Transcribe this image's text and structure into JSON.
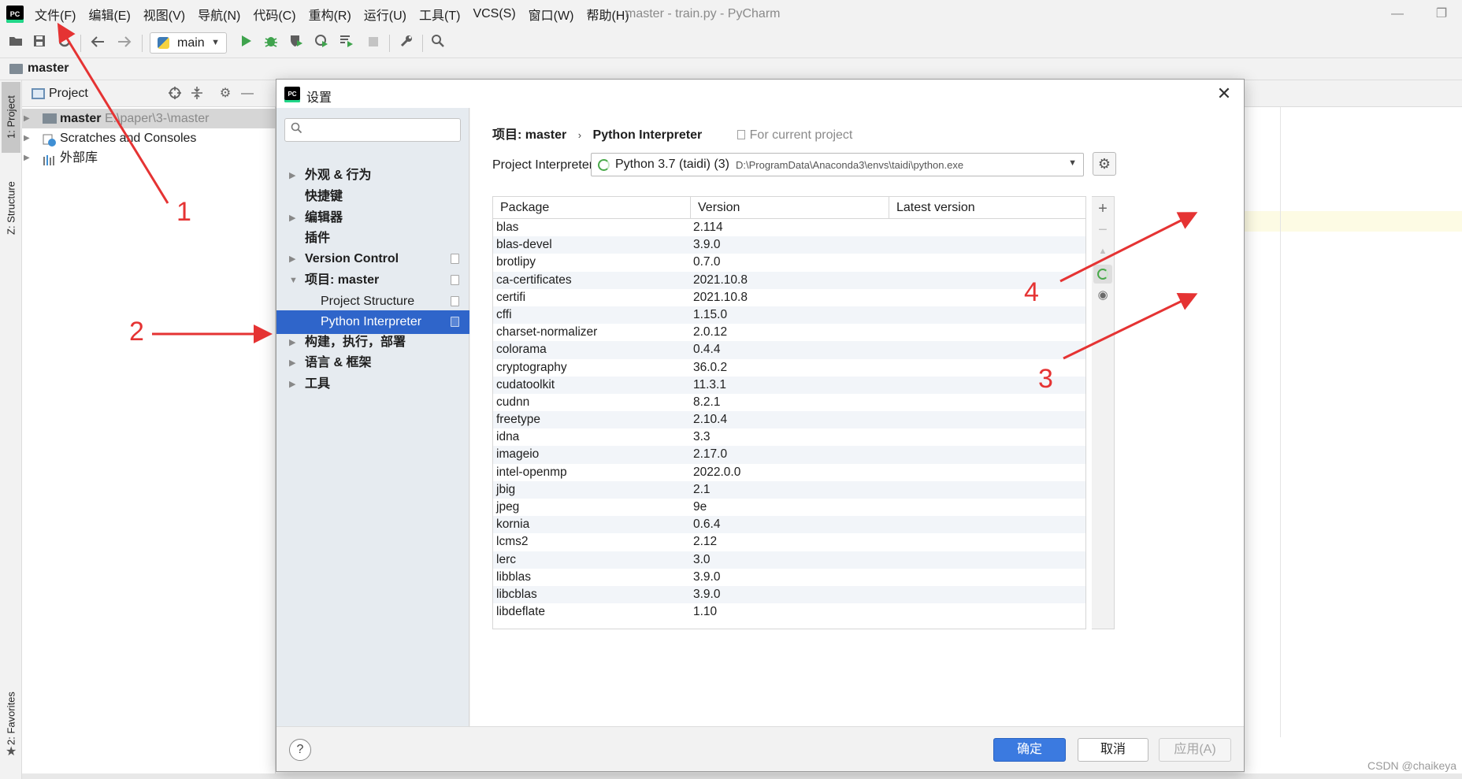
{
  "window": {
    "title": "master - train.py - PyCharm",
    "logo_text": "PC",
    "minimize": "—",
    "restore": "❐"
  },
  "menu": [
    "文件(F)",
    "编辑(E)",
    "视图(V)",
    "导航(N)",
    "代码(C)",
    "重构(R)",
    "运行(U)",
    "工具(T)",
    "VCS(S)",
    "窗口(W)",
    "帮助(H)"
  ],
  "toolbar": {
    "run_config": "main"
  },
  "navbar": {
    "root": "master"
  },
  "left_stripe": {
    "project_tab": "1: Project",
    "structure_tab": "Z: Structure",
    "favorites_tab": "2: Favorites"
  },
  "project_panel": {
    "title": "Project",
    "tree": [
      {
        "name": "master",
        "path": "E:\\paper\\3-\\master"
      },
      {
        "name": "Scratches and Consoles"
      },
      {
        "name": "外部库"
      }
    ]
  },
  "dialog": {
    "title": "设置",
    "logo_text": "PC",
    "close": "✕",
    "nav": [
      {
        "label": "外观 & 行为"
      },
      {
        "label": "快捷键"
      },
      {
        "label": "编辑器"
      },
      {
        "label": "插件"
      },
      {
        "label": "Version Control"
      },
      {
        "label": "项目: master"
      },
      {
        "label": "Project Structure"
      },
      {
        "label": "Python Interpreter"
      },
      {
        "label": "构建，执行，部署"
      },
      {
        "label": "语言 & 框架"
      },
      {
        "label": "工具"
      }
    ],
    "breadcrumb": {
      "project": "项目: master",
      "sep": "›",
      "page": "Python Interpreter",
      "scope": "For current project"
    },
    "interpreter": {
      "label": "Project Interpreter:",
      "name": "Python 3.7 (taidi) (3)",
      "path": "D:\\ProgramData\\Anaconda3\\envs\\taidi\\python.exe"
    },
    "table": {
      "headers": [
        "Package",
        "Version",
        "Latest version"
      ],
      "rows": [
        [
          "blas",
          "2.114",
          ""
        ],
        [
          "blas-devel",
          "3.9.0",
          ""
        ],
        [
          "brotlipy",
          "0.7.0",
          ""
        ],
        [
          "ca-certificates",
          "2021.10.8",
          ""
        ],
        [
          "certifi",
          "2021.10.8",
          ""
        ],
        [
          "cffi",
          "1.15.0",
          ""
        ],
        [
          "charset-normalizer",
          "2.0.12",
          ""
        ],
        [
          "colorama",
          "0.4.4",
          ""
        ],
        [
          "cryptography",
          "36.0.2",
          ""
        ],
        [
          "cudatoolkit",
          "11.3.1",
          ""
        ],
        [
          "cudnn",
          "8.2.1",
          ""
        ],
        [
          "freetype",
          "2.10.4",
          ""
        ],
        [
          "idna",
          "3.3",
          ""
        ],
        [
          "imageio",
          "2.17.0",
          ""
        ],
        [
          "intel-openmp",
          "2022.0.0",
          ""
        ],
        [
          "jbig",
          "2.1",
          ""
        ],
        [
          "jpeg",
          "9e",
          ""
        ],
        [
          "kornia",
          "0.6.4",
          ""
        ],
        [
          "lcms2",
          "2.12",
          ""
        ],
        [
          "lerc",
          "3.0",
          ""
        ],
        [
          "libblas",
          "3.9.0",
          ""
        ],
        [
          "libcblas",
          "3.9.0",
          ""
        ],
        [
          "libdeflate",
          "1.10",
          ""
        ]
      ]
    },
    "actions": {
      "add": "+",
      "remove": "−",
      "up": "▲",
      "show": "◉"
    },
    "footer": {
      "help": "?",
      "ok": "确定",
      "cancel": "取消",
      "apply": "应用(A)"
    }
  },
  "annotations": [
    "1",
    "2",
    "3",
    "4"
  ],
  "watermark": "CSDN @chaikeya",
  "colors": {
    "accent": "#2f65ca",
    "ok_button": "#3b7ae0",
    "annotation_red": "#e53333",
    "loading_green": "#49a94a"
  },
  "icons": {
    "toolbar": [
      "open-folder-icon",
      "save-icon",
      "sync-icon",
      "back-icon",
      "forward-icon",
      "run-icon",
      "debug-icon",
      "coverage-icon",
      "profile-icon",
      "concurrency-icon",
      "stop-icon",
      "settings-wrench-icon",
      "search-icon"
    ],
    "project_header": [
      "locate-icon",
      "collapse-icon",
      "gear-icon",
      "hide-icon"
    ]
  }
}
